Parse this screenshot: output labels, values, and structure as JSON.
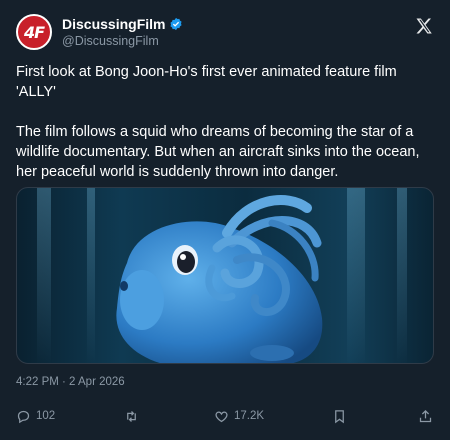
{
  "author": {
    "display_name": "DiscussingFilm",
    "handle": "@DiscussingFilm",
    "avatar_text": "4F",
    "verified": true
  },
  "tweet": {
    "text": "First look at Bong Joon-Ho's first ever animated feature film 'ALLY'\n\nThe film follows a squid who dreams of becoming the star of a wildlife documentary. But when an aircraft sinks into the ocean, her peaceful world is suddenly thrown into danger.",
    "timestamp": "4:22 PM · 2 Apr 2026"
  },
  "actions": {
    "reply_count": "102",
    "retweet_count": "",
    "like_count": "17.2K"
  },
  "colors": {
    "background": "#15202b",
    "secondary_text": "#8b98a5",
    "verified_blue": "#1d9bf0",
    "avatar_red": "#c8202a"
  },
  "icons": [
    "verified-badge-icon",
    "x-logo-icon",
    "reply-icon",
    "retweet-icon",
    "like-icon",
    "bookmark-icon",
    "share-icon"
  ]
}
